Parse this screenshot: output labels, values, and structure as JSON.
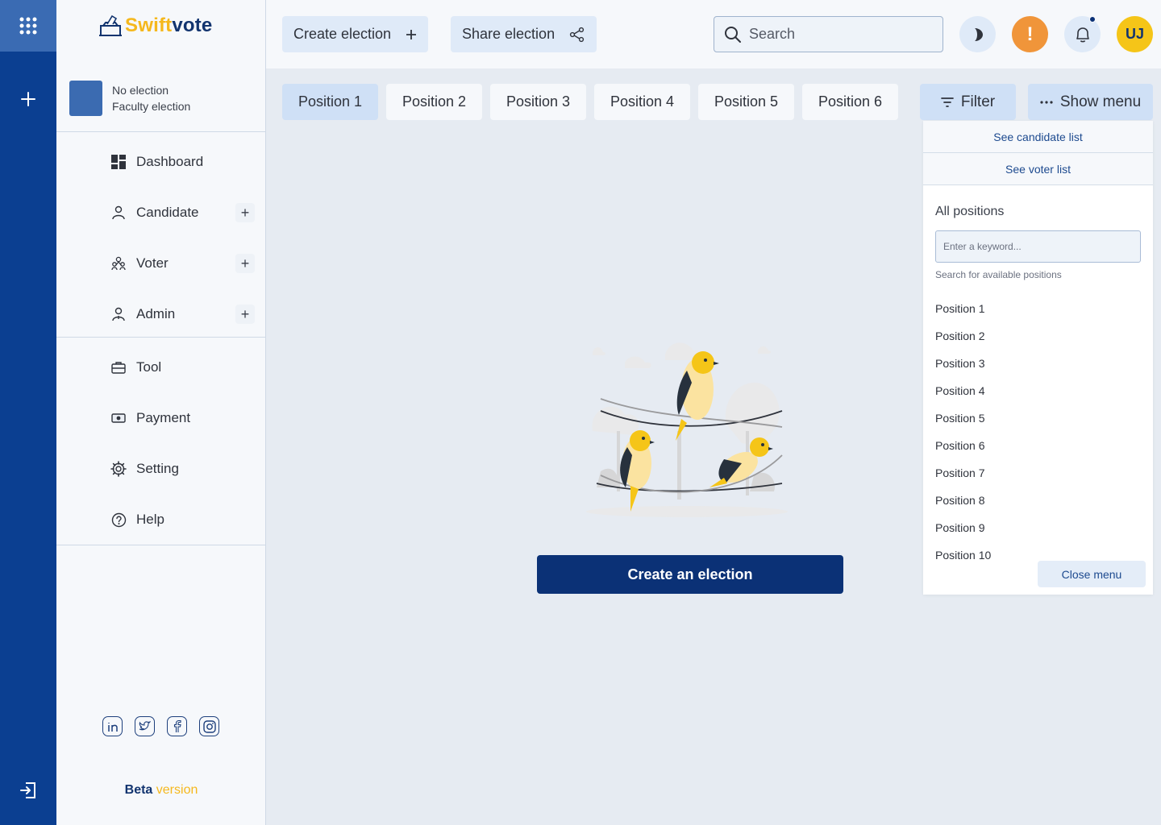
{
  "app": {
    "brand_part1": "Swift",
    "brand_part2": "vote",
    "accent_color": "#f5b81d",
    "primary_color": "#0b3176"
  },
  "rail": {
    "apps_icon": "grid-icon",
    "add_icon": "plus-icon",
    "logout_icon": "logout-icon"
  },
  "election_card": {
    "title": "No election",
    "subtitle": "Faculty election"
  },
  "sidebar": {
    "items": [
      {
        "label": "Dashboard",
        "icon": "dashboard-icon"
      },
      {
        "label": "Candidate",
        "icon": "person-icon",
        "addable": true
      },
      {
        "label": "Voter",
        "icon": "group-icon",
        "addable": true
      },
      {
        "label": "Admin",
        "icon": "admin-icon",
        "addable": true
      },
      {
        "label": "Tool",
        "icon": "toolbox-icon"
      },
      {
        "label": "Payment",
        "icon": "cash-icon"
      },
      {
        "label": "Setting",
        "icon": "gear-icon"
      },
      {
        "label": "Help",
        "icon": "help-icon"
      }
    ],
    "socials": [
      "linkedin-icon",
      "twitter-icon",
      "facebook-icon",
      "instagram-icon"
    ],
    "beta_part1": "Beta",
    "beta_part2": "version"
  },
  "topbar": {
    "create_label": "Create election",
    "share_label": "Share election",
    "search_placeholder": "Search",
    "avatar_initials": "UJ",
    "alert_glyph": "!"
  },
  "tabs": [
    "Position 1",
    "Position 2",
    "Position 3",
    "Position 4",
    "Position 5",
    "Position 6"
  ],
  "active_tab": "Position 1",
  "actions": {
    "filter_label": "Filter",
    "menu_label": "Show menu"
  },
  "main": {
    "cta_label": "Create an election"
  },
  "menu_panel": {
    "candidate_link": "See candidate list",
    "voter_link": "See voter list",
    "title": "All positions",
    "keyword_placeholder": "Enter a keyword...",
    "help_text": "Search for available positions",
    "positions": [
      "Position 1",
      "Position 2",
      "Position 3",
      "Position 4",
      "Position 5",
      "Position 6",
      "Position 7",
      "Position 8",
      "Position 9",
      "Position 10"
    ],
    "close_label": "Close menu"
  }
}
